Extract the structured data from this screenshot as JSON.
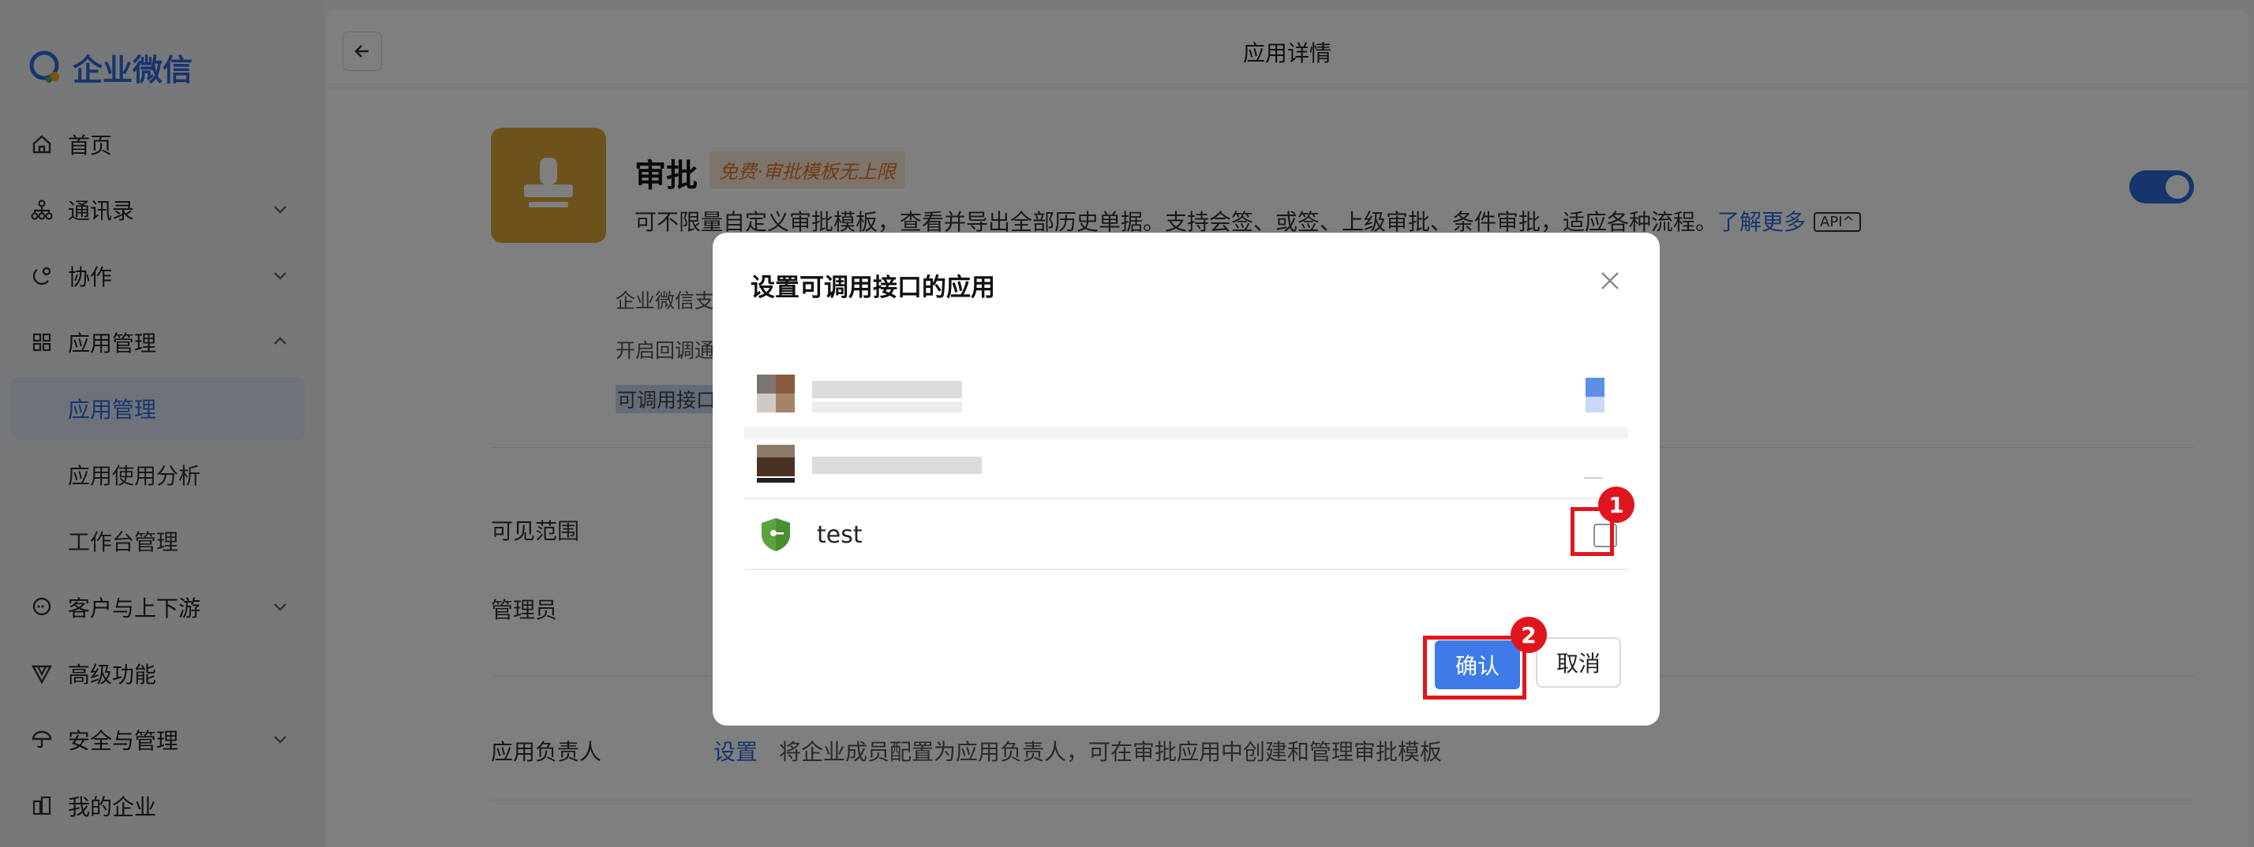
{
  "sidebar": {
    "logo_text": "企业微信",
    "items": [
      {
        "label": "首页",
        "icon": "home-icon"
      },
      {
        "label": "通讯录",
        "icon": "org-tree-icon"
      },
      {
        "label": "协作",
        "icon": "collab-icon"
      },
      {
        "label": "应用管理",
        "icon": "grid-icon"
      },
      {
        "label": "客户与上下游",
        "icon": "chat-bubble-icon"
      },
      {
        "label": "高级功能",
        "icon": "v-icon"
      },
      {
        "label": "安全与管理",
        "icon": "umbrella-icon"
      },
      {
        "label": "我的企业",
        "icon": "building-icon"
      }
    ],
    "sub_items": [
      {
        "label": "应用管理",
        "active": true
      },
      {
        "label": "应用使用分析",
        "active": false
      },
      {
        "label": "工作台管理",
        "active": false
      }
    ]
  },
  "header": {
    "title": "应用详情"
  },
  "app": {
    "name": "审批",
    "tag": "免费·审批模板无上限",
    "description": "可不限量自定义审批模板，查看并导出全部历史单据。支持会签、或签、上级审批、条件审批，适应各种流程。",
    "learn_more": "了解更多",
    "api_badge": "API",
    "enabled": true
  },
  "info_lines": [
    "企业微信支",
    "开启回调通",
    "可调用接口"
  ],
  "fields": {
    "visible_range": "可见范围",
    "admin": "管理员",
    "owner": "应用负责人",
    "owner_link": "设置",
    "owner_desc": "将企业成员配置为应用负责人，可在审批应用中创建和管理审批模板"
  },
  "dialog": {
    "title": "设置可调用接口的应用",
    "rows": [
      {
        "name": "",
        "blurred": true
      },
      {
        "name": "",
        "blurred": true
      },
      {
        "name": "test",
        "blurred": false,
        "checked": false
      }
    ],
    "confirm_label": "确认",
    "cancel_label": "取消"
  },
  "annotations": [
    {
      "number": "1",
      "target": "test-checkbox"
    },
    {
      "number": "2",
      "target": "confirm-button"
    }
  ],
  "colors": {
    "accent": "#2f6bdb",
    "confirm_button": "#3e7be8",
    "app_icon": "#d9a739",
    "highlight": "#e0161e"
  }
}
